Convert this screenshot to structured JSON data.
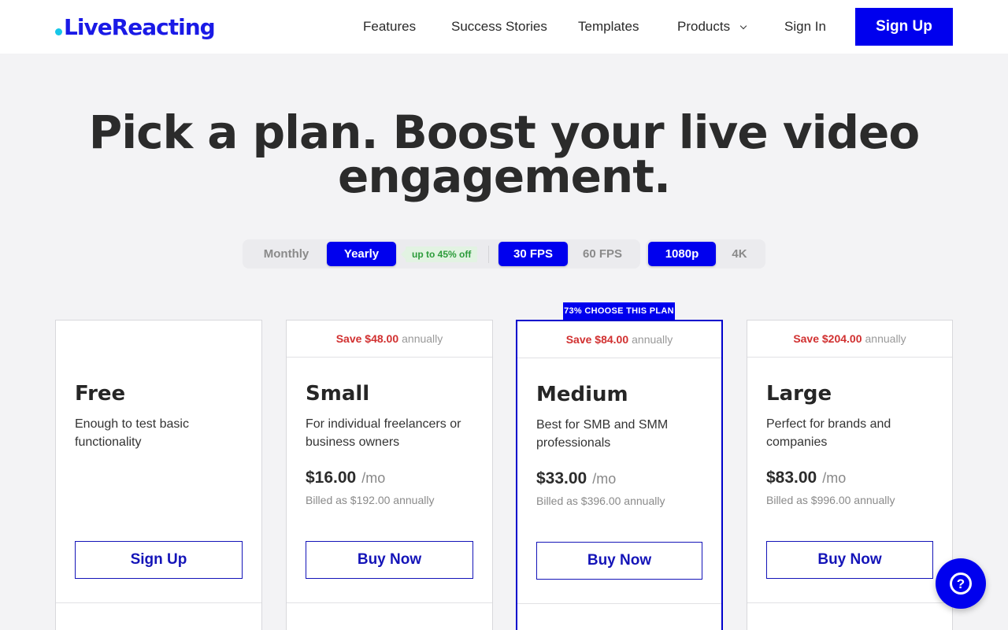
{
  "header": {
    "logo_text": "LiveReacting",
    "nav": [
      "Features",
      "Success Stories",
      "Templates",
      "Products",
      "Sign In"
    ],
    "signup_label": "Sign Up"
  },
  "hero": {
    "line1": "Pick a plan. Boost your live video",
    "line2": "engagement."
  },
  "toggles": {
    "billing": {
      "options": [
        "Monthly",
        "Yearly"
      ],
      "selected": "Yearly",
      "badge": "up to 45% off"
    },
    "fps": {
      "options": [
        "30 FPS",
        "60 FPS"
      ],
      "selected": "30 FPS"
    },
    "resolution": {
      "options": [
        "1080p",
        "4K"
      ],
      "selected": "1080p"
    }
  },
  "featured_badge": "73% CHOOSE THIS PLAN",
  "plans": [
    {
      "name": "Free",
      "description": "Enough to test basic functionality",
      "save_amount": "",
      "save_period": "",
      "price": "",
      "per": "",
      "billed": "",
      "button": "Sign Up"
    },
    {
      "name": "Small",
      "description": "For individual freelancers or business owners",
      "save_amount": "Save $48.00",
      "save_period": "annually",
      "price": "$16.00",
      "per": "/mo",
      "billed": "Billed as $192.00 annually",
      "button": "Buy Now"
    },
    {
      "name": "Medium",
      "description": "Best for SMB and SMM professionals",
      "save_amount": "Save $84.00",
      "save_period": "annually",
      "price": "$33.00",
      "per": "/mo",
      "billed": "Billed as $396.00 annually",
      "button": "Buy Now"
    },
    {
      "name": "Large",
      "description": "Perfect for brands and companies",
      "save_amount": "Save $204.00",
      "save_period": "annually",
      "price": "$83.00",
      "per": "/mo",
      "billed": "Billed as $996.00 annually",
      "button": "Buy Now"
    }
  ],
  "help_icon_label": "?",
  "colors": {
    "brand_blue": "#0000ee",
    "save_red": "#d13030",
    "discount_green": "#2c9b3a",
    "logo_dot": "#16c7e8"
  },
  "icons": [
    "chevron-down-icon",
    "help-icon"
  ]
}
